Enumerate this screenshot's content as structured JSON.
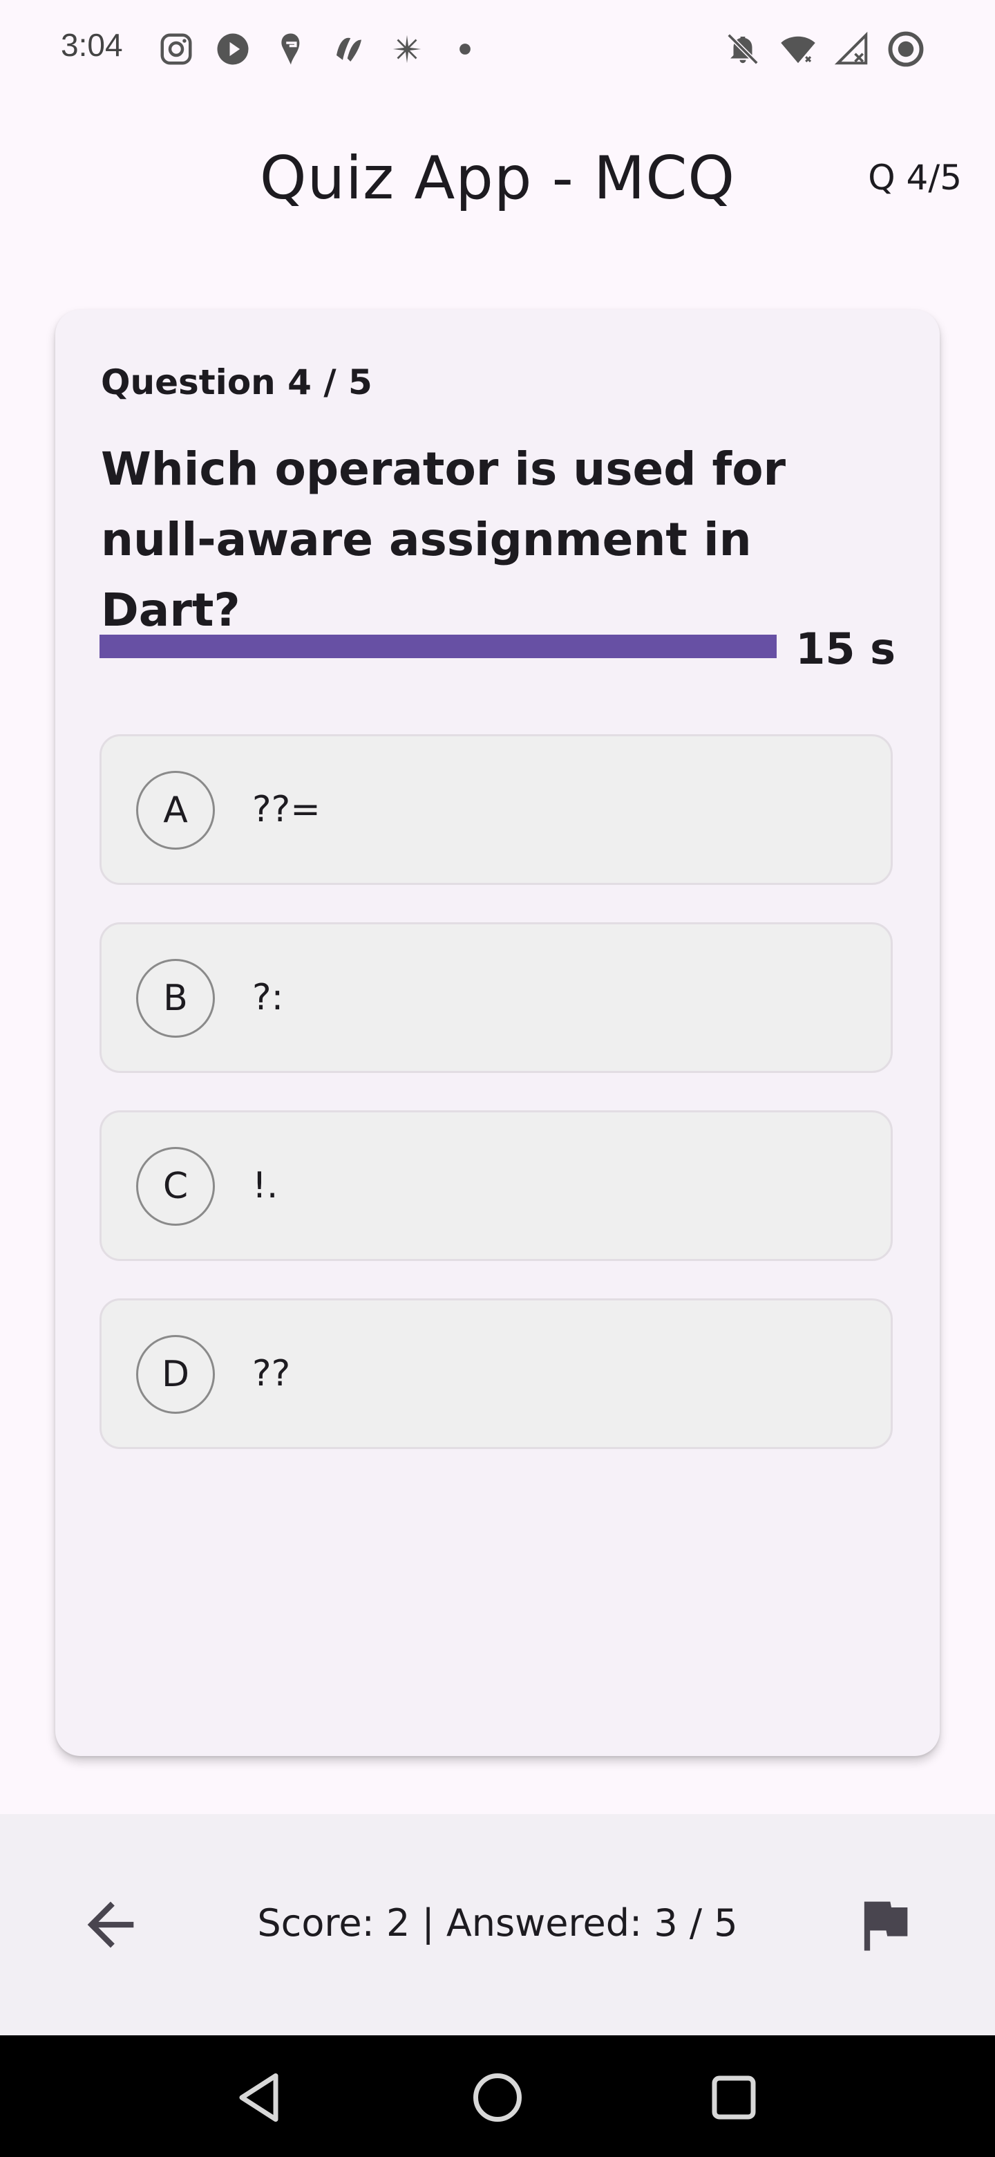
{
  "status_bar": {
    "time": "3:04",
    "left_icons": [
      "instagram-icon",
      "play-icon",
      "swiggy-icon",
      "app-icon",
      "sparkle-icon",
      "dot-icon"
    ],
    "right_icons": [
      "notifications-off-icon",
      "wifi-icon",
      "signal-icon",
      "record-icon"
    ]
  },
  "app_bar": {
    "title": "Quiz App - MCQ",
    "question_counter": "Q 4/5"
  },
  "question": {
    "label": "Question 4 / 5",
    "text": "Which operator is used for null-aware assignment in Dart?",
    "timer_text": "15 s",
    "timer_fraction": 1.0,
    "timer_color": "#6750a4"
  },
  "options": [
    {
      "letter": "A",
      "text": "??="
    },
    {
      "letter": "B",
      "text": "?:"
    },
    {
      "letter": "C",
      "text": "!."
    },
    {
      "letter": "D",
      "text": "??"
    }
  ],
  "bottom_bar": {
    "back_icon": "arrow-back-icon",
    "score_text": "Score: 2 | Answered: 3 / 5",
    "flag_icon": "flag-icon"
  },
  "nav_bar": {
    "buttons": [
      "back-triangle-icon",
      "home-circle-icon",
      "recents-square-icon"
    ]
  }
}
